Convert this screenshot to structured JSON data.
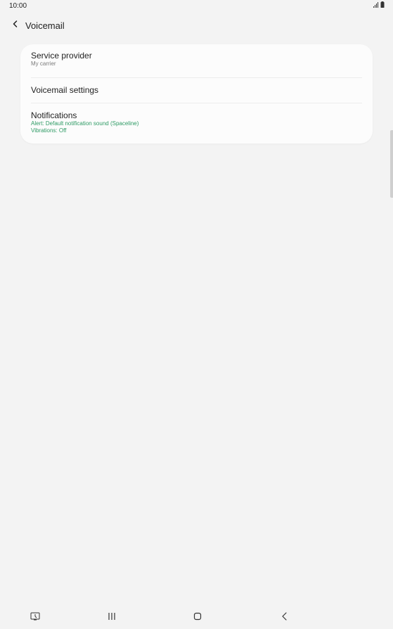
{
  "status_bar": {
    "time": "10:00",
    "signal_icon": "signal-icon",
    "battery_icon": "battery-icon"
  },
  "header": {
    "back_icon": "chevron-left-icon",
    "title": "Voicemail"
  },
  "card": {
    "service_provider": {
      "title": "Service provider",
      "subtitle": "My carrier"
    },
    "voicemail_settings": {
      "title": "Voicemail settings"
    },
    "notifications": {
      "title": "Notifications",
      "alert": "Alert: Default notification sound (Spaceline)",
      "vibrations": "Vibrations: Off"
    }
  },
  "colors": {
    "background": "#f3f3f3",
    "card": "#fcfcfc",
    "accent_green": "#2f9b65",
    "subtitle_gray": "#7b7b7b"
  },
  "nav_bar": {
    "left_icon": "screenshot-icon",
    "recents_icon": "recents-icon",
    "home_icon": "home-icon",
    "back_icon": "back-icon"
  }
}
